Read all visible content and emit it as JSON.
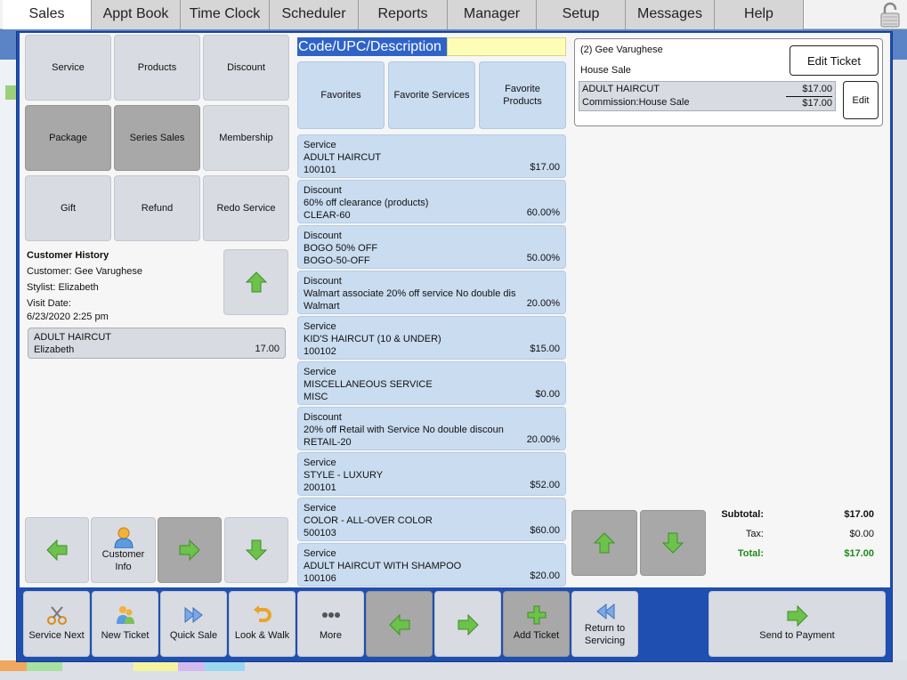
{
  "nav": {
    "tabs": [
      "Sales",
      "Appt Book",
      "Time Clock",
      "Scheduler",
      "Reports",
      "Manager",
      "Setup",
      "Messages",
      "Help"
    ],
    "active": "Sales"
  },
  "category_tiles": [
    "Service",
    "Products",
    "Discount",
    "Package",
    "Series Sales",
    "Membership",
    "Gift",
    "Refund",
    "Redo Service"
  ],
  "search": {
    "label": "Code/UPC/Description",
    "value": ""
  },
  "favorites": {
    "favorites": "Favorites",
    "favorite_services": "Favorite Services",
    "favorite_products_line1": "Favorite",
    "favorite_products_line2": "Products"
  },
  "items": [
    {
      "type": "Service",
      "name": "ADULT HAIRCUT",
      "code": "100101",
      "price": "$17.00"
    },
    {
      "type": "Discount",
      "name": "60% off clearance (products)",
      "code": "CLEAR-60",
      "price": "60.00%"
    },
    {
      "type": "Discount",
      "name": "BOGO 50% OFF",
      "code": "BOGO-50-OFF",
      "price": "50.00%"
    },
    {
      "type": "Discount",
      "name": "Walmart associate 20% off service No double dis",
      "code": "Walmart",
      "price": "20.00%"
    },
    {
      "type": "Service",
      "name": "KID'S HAIRCUT (10 & UNDER)",
      "code": "100102",
      "price": "$15.00"
    },
    {
      "type": "Service",
      "name": "MISCELLANEOUS SERVICE",
      "code": "MISC",
      "price": "$0.00"
    },
    {
      "type": "Discount",
      "name": "20% off Retail with Service No double discoun",
      "code": "RETAIL-20",
      "price": "20.00%"
    },
    {
      "type": "Service",
      "name": "STYLE - LUXURY",
      "code": "200101",
      "price": "$52.00"
    },
    {
      "type": "Service",
      "name": "COLOR - ALL-OVER COLOR",
      "code": "500103",
      "price": "$60.00"
    },
    {
      "type": "Service",
      "name": "ADULT HAIRCUT WITH SHAMPOO",
      "code": "100106",
      "price": "$20.00"
    }
  ],
  "customer_history": {
    "title": "Customer History",
    "customer": "Customer: Gee Varughese",
    "stylist": "Stylist: Elizabeth",
    "visit_label": "Visit Date:",
    "visit_date": "6/23/2020 2:25 pm",
    "entry": {
      "service": "ADULT HAIRCUT",
      "stylist": "Elizabeth",
      "amount": "17.00"
    }
  },
  "customer_info": {
    "line1": "Customer",
    "line2": "Info"
  },
  "ticket": {
    "customer": "(2) Gee Varughese",
    "sale_type": "House Sale",
    "edit_ticket": "Edit Ticket",
    "edit": "Edit",
    "line": {
      "service": "ADULT HAIRCUT",
      "price": "$17.00",
      "commission": "Commission:House Sale",
      "commission_price": "$17.00"
    }
  },
  "totals": {
    "subtotal_label": "Subtotal:",
    "subtotal": "$17.00",
    "tax_label": "Tax:",
    "tax": "$0.00",
    "total_label": "Total:",
    "total": "$17.00"
  },
  "bottom_bar": {
    "service_next": "Service Next",
    "new_ticket": "New Ticket",
    "quick_sale": "Quick Sale",
    "look_walk": "Look & Walk",
    "more": "More",
    "add_ticket": "Add Ticket",
    "return_line1": "Return to",
    "return_line2": "Servicing",
    "send_to_payment": "Send to Payment"
  },
  "colors": {
    "modal_blue": "#1f4fb0",
    "item_blue": "#c9dcf0",
    "total_green": "#1e8a1e",
    "arrow_green": "#6cc24a"
  }
}
